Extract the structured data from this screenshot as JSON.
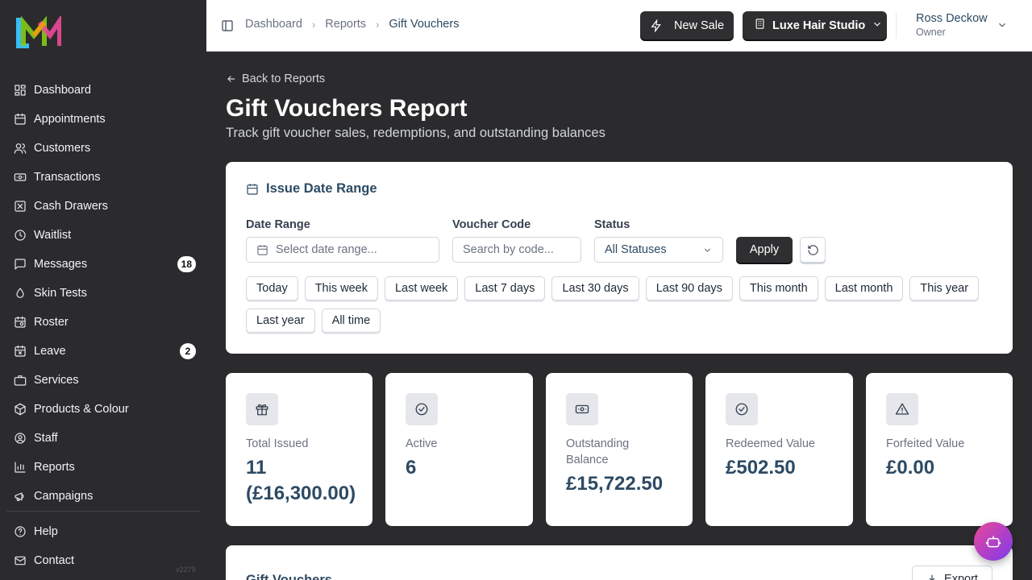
{
  "sidebar": {
    "items": [
      {
        "label": "Dashboard"
      },
      {
        "label": "Appointments"
      },
      {
        "label": "Customers"
      },
      {
        "label": "Transactions"
      },
      {
        "label": "Cash Drawers"
      },
      {
        "label": "Waitlist"
      },
      {
        "label": "Messages",
        "badge": "18"
      },
      {
        "label": "Skin Tests"
      },
      {
        "label": "Roster"
      },
      {
        "label": "Leave",
        "badge": "2"
      },
      {
        "label": "Services"
      },
      {
        "label": "Products & Colour"
      },
      {
        "label": "Staff"
      },
      {
        "label": "Reports"
      },
      {
        "label": "Campaigns"
      }
    ],
    "bottom_items": [
      {
        "label": "Help"
      },
      {
        "label": "Contact"
      }
    ],
    "version": "v2279"
  },
  "topbar": {
    "breadcrumb": [
      "Dashboard",
      "Reports",
      "Gift Vouchers"
    ],
    "new_sale_label": "New Sale",
    "studio_label": "Luxe Hair Studio",
    "user_name": "Ross Deckow",
    "user_role": "Owner"
  },
  "main": {
    "back_label": "Back to Reports",
    "title": "Gift Vouchers Report",
    "subtitle": "Track gift voucher sales, redemptions, and outstanding balances"
  },
  "filters": {
    "heading": "Issue Date Range",
    "date_range_label": "Date Range",
    "date_range_placeholder": "Select date range...",
    "voucher_code_label": "Voucher Code",
    "voucher_code_placeholder": "Search by code...",
    "status_label": "Status",
    "status_value": "All Statuses",
    "apply_label": "Apply",
    "presets": [
      "Today",
      "This week",
      "Last week",
      "Last 7 days",
      "Last 30 days",
      "Last 90 days",
      "This month",
      "Last month",
      "This year",
      "Last year",
      "All time"
    ]
  },
  "stats": [
    {
      "label": "Total Issued",
      "value": "11 (£16,300.00)",
      "icon": "gift-icon"
    },
    {
      "label": "Active",
      "value": "6",
      "icon": "check-circle-icon"
    },
    {
      "label": "Outstanding Balance",
      "value": "£15,722.50",
      "icon": "banknote-icon"
    },
    {
      "label": "Redeemed Value",
      "value": "£502.50",
      "icon": "check-circle-icon"
    },
    {
      "label": "Forfeited Value",
      "value": "£0.00",
      "icon": "alert-triangle-icon"
    }
  ],
  "vouchers": {
    "title": "Gift Vouchers",
    "export_label": "Export"
  },
  "colors": {
    "accent": "#2d4a63",
    "sidebar_bg": "#2b2b2d",
    "fab_gradient": [
      "#ec4899",
      "#7c3aed"
    ]
  }
}
